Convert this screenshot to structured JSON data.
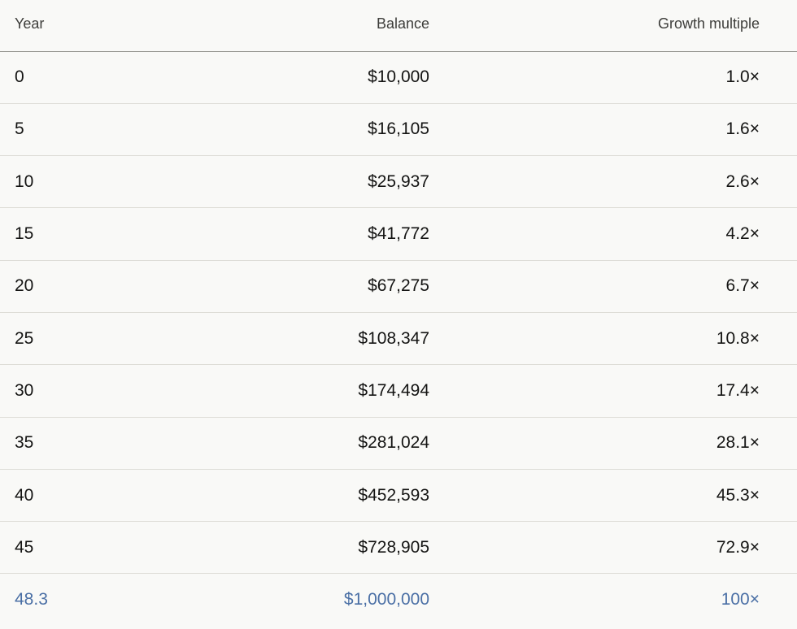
{
  "table": {
    "headers": {
      "year": "Year",
      "balance": "Balance",
      "growth": "Growth multiple"
    },
    "rows": [
      {
        "year": "0",
        "balance": "$10,000",
        "growth": "1.0×"
      },
      {
        "year": "5",
        "balance": "$16,105",
        "growth": "1.6×"
      },
      {
        "year": "10",
        "balance": "$25,937",
        "growth": "2.6×"
      },
      {
        "year": "15",
        "balance": "$41,772",
        "growth": "4.2×"
      },
      {
        "year": "20",
        "balance": "$67,275",
        "growth": "6.7×"
      },
      {
        "year": "25",
        "balance": "$108,347",
        "growth": "10.8×"
      },
      {
        "year": "30",
        "balance": "$174,494",
        "growth": "17.4×"
      },
      {
        "year": "35",
        "balance": "$281,024",
        "growth": "28.1×"
      },
      {
        "year": "40",
        "balance": "$452,593",
        "growth": "45.3×"
      },
      {
        "year": "45",
        "balance": "$728,905",
        "growth": "72.9×"
      },
      {
        "year": "48.3",
        "balance": "$1,000,000",
        "growth": "100×"
      }
    ],
    "highlight_color": "#4a6fa5"
  }
}
